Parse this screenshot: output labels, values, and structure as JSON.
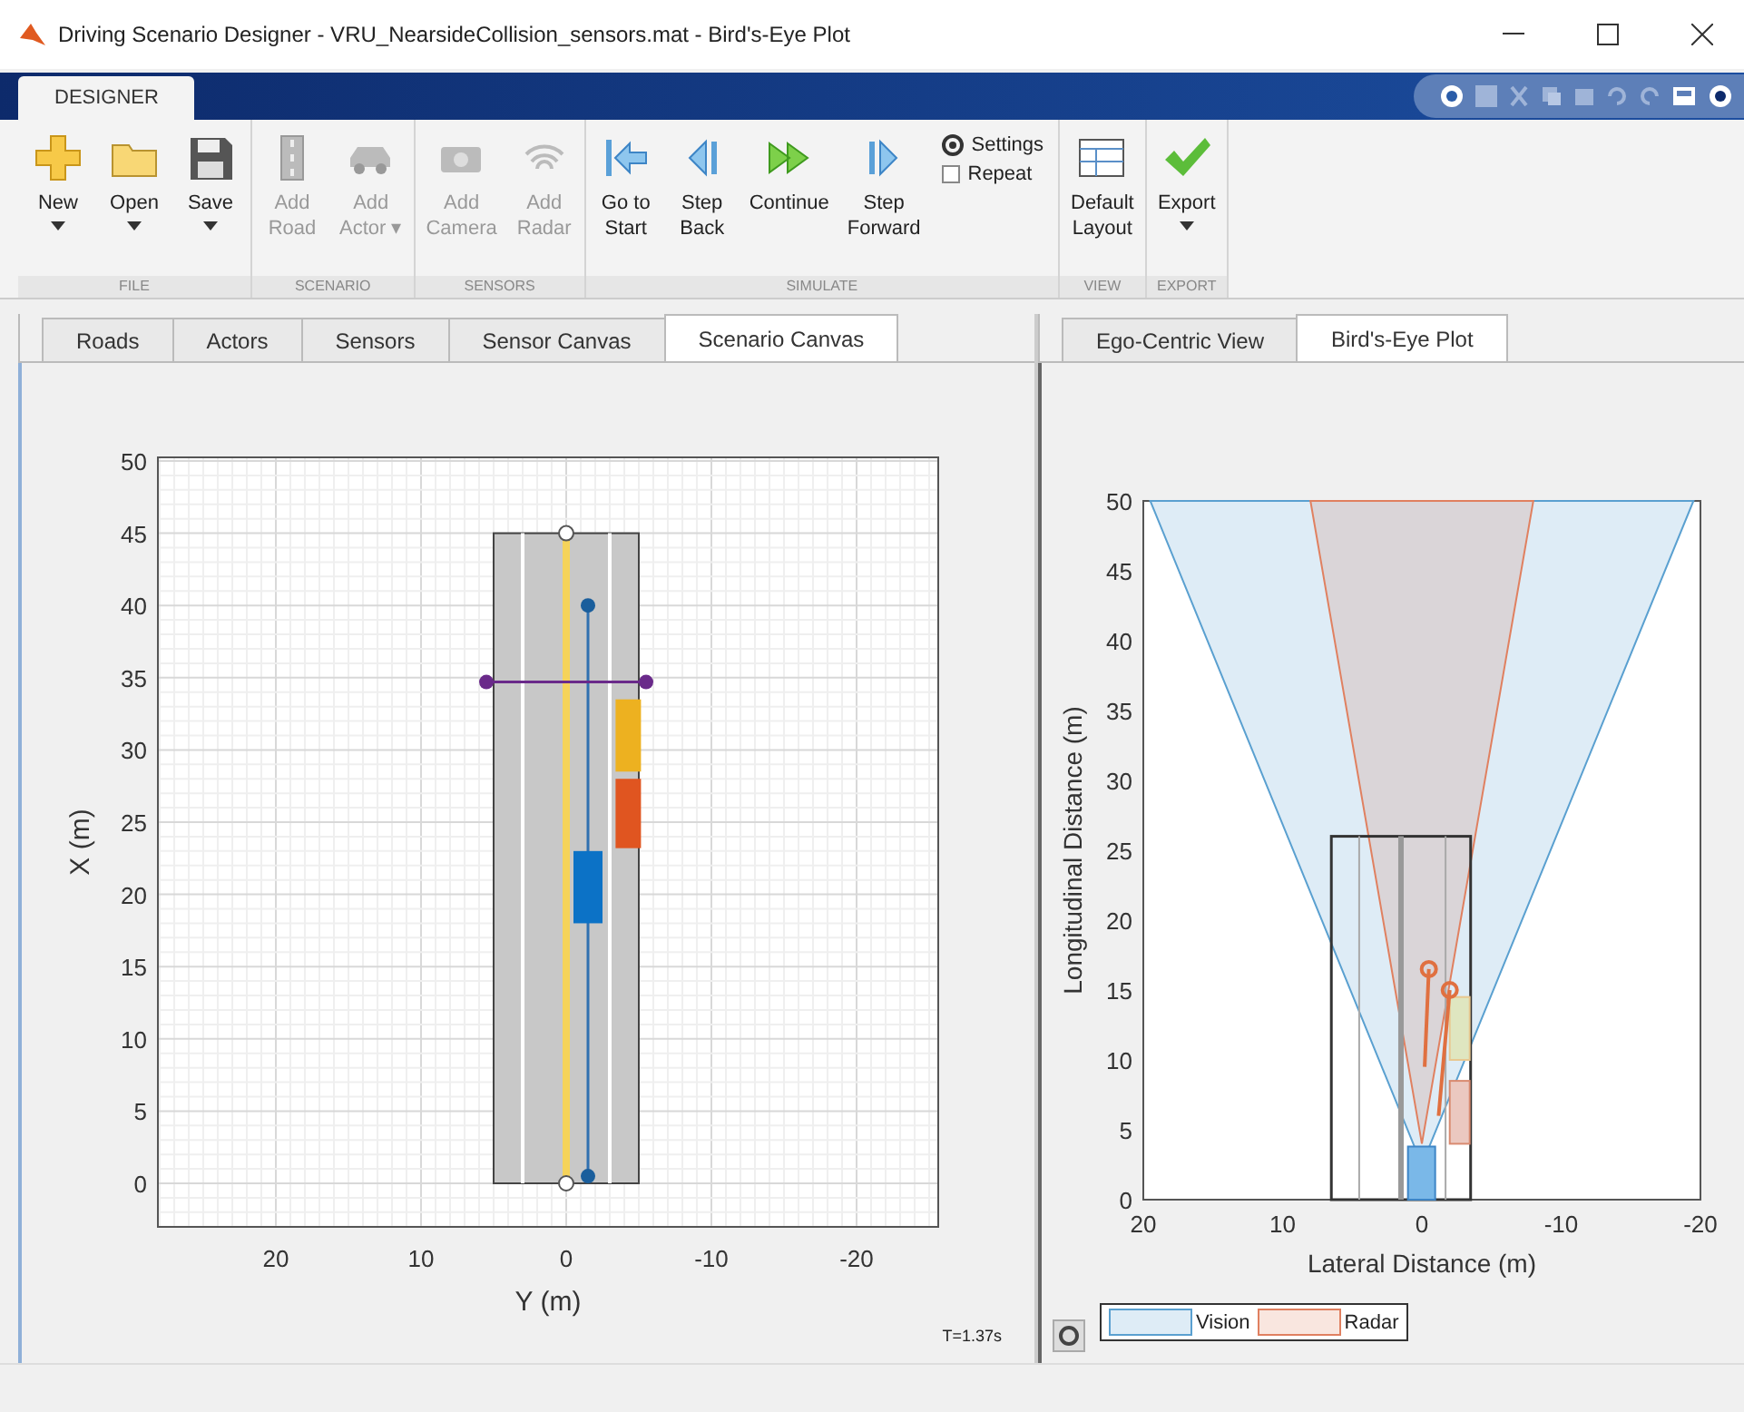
{
  "window": {
    "title": "Driving Scenario Designer - VRU_NearsideCollision_sensors.mat - Bird's-Eye Plot"
  },
  "ribbon": {
    "tabs": [
      {
        "label": "DESIGNER",
        "selected": true
      }
    ],
    "groups": [
      {
        "label": "FILE",
        "items": [
          {
            "kind": "large",
            "label": "New",
            "dropdown": true,
            "disabled": false
          },
          {
            "kind": "large",
            "label": "Open",
            "dropdown": true,
            "disabled": false
          },
          {
            "kind": "large",
            "label": "Save",
            "dropdown": true,
            "disabled": false
          }
        ]
      },
      {
        "label": "SCENARIO",
        "items": [
          {
            "kind": "large",
            "label": "Add\nRoad",
            "disabled": true
          },
          {
            "kind": "large",
            "label": "Add\nActor ▾",
            "disabled": true
          }
        ]
      },
      {
        "label": "SENSORS",
        "items": [
          {
            "kind": "large",
            "label": "Add\nCamera",
            "disabled": true
          },
          {
            "kind": "large",
            "label": "Add\nRadar",
            "disabled": true
          }
        ]
      },
      {
        "label": "SIMULATE",
        "items": [
          {
            "kind": "large",
            "label": "Go to\nStart",
            "disabled": false
          },
          {
            "kind": "large",
            "label": "Step\nBack",
            "disabled": false
          },
          {
            "kind": "large",
            "label": "Continue",
            "disabled": false
          },
          {
            "kind": "large",
            "label": "Step\nForward",
            "disabled": false
          },
          {
            "kind": "small",
            "label": "Settings"
          },
          {
            "kind": "check",
            "label": "Repeat",
            "checked": false
          }
        ]
      },
      {
        "label": "VIEW",
        "items": [
          {
            "kind": "large",
            "label": "Default\nLayout",
            "disabled": false
          }
        ]
      },
      {
        "label": "EXPORT",
        "items": [
          {
            "kind": "large",
            "label": "Export",
            "dropdown": true,
            "disabled": false
          }
        ]
      }
    ]
  },
  "left_panel": {
    "tabs": [
      {
        "label": "Roads",
        "selected": false
      },
      {
        "label": "Actors",
        "selected": false
      },
      {
        "label": "Sensors",
        "selected": false
      },
      {
        "label": "Sensor Canvas",
        "selected": false
      },
      {
        "label": "Scenario Canvas",
        "selected": true
      }
    ],
    "plot": {
      "xlabel": "Y (m)",
      "ylabel": "X (m)",
      "xticks": [
        "20",
        "10",
        "0",
        "-10",
        "-20"
      ],
      "yticks": [
        "50",
        "45",
        "40",
        "35",
        "30",
        "25",
        "20",
        "15",
        "10",
        "5",
        "0"
      ]
    },
    "time": "T=1.37s"
  },
  "right_panel": {
    "tabs": [
      {
        "label": "Ego-Centric View",
        "selected": false
      },
      {
        "label": "Bird's-Eye Plot",
        "selected": true
      }
    ],
    "plot": {
      "xlabel": "Lateral Distance (m)",
      "ylabel": "Longitudinal Distance (m)",
      "xticks": [
        "20",
        "10",
        "0",
        "-10",
        "-20"
      ],
      "yticks": [
        "50",
        "45",
        "40",
        "35",
        "30",
        "25",
        "20",
        "15",
        "10",
        "5",
        "0"
      ]
    },
    "legend": [
      {
        "label": "Vision",
        "color": "#5aa0d0"
      },
      {
        "label": "Radar",
        "color": "#e08060"
      }
    ]
  }
}
